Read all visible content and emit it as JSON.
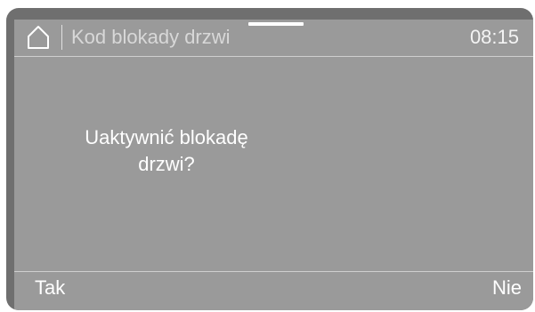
{
  "header": {
    "home_icon": "home-icon",
    "title": "Kod blokady drzwi",
    "time": "08:15"
  },
  "dialog": {
    "message_line1": "Uaktywnić blokadę",
    "message_line2": "drzwi?"
  },
  "footer": {
    "left_label": "Tak",
    "right_label": "Nie"
  },
  "colors": {
    "bezel": "#6f6f6f",
    "screen": "#9a9a9a",
    "text": "#ffffff",
    "divider": "#cfcfcf"
  }
}
